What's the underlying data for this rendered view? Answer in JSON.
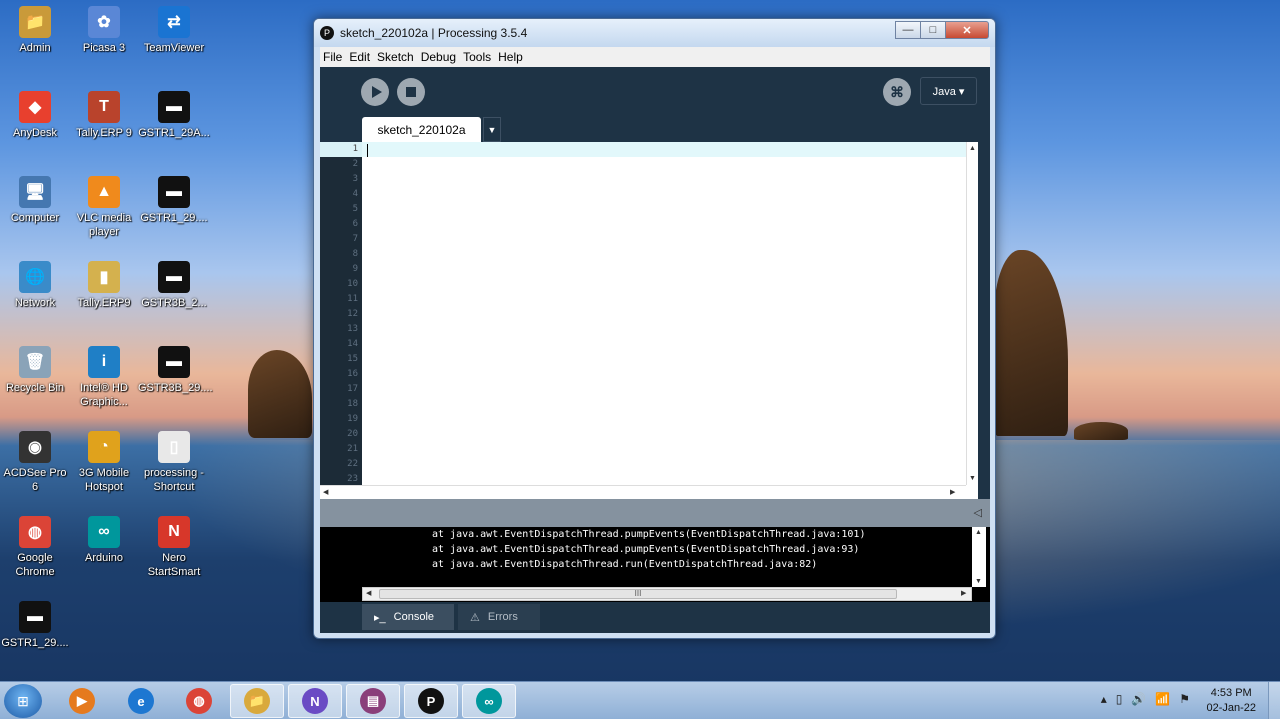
{
  "desktop": {
    "icons": [
      {
        "label": "Admin",
        "glyph": "📁",
        "color": "#c99a3a"
      },
      {
        "label": "Picasa 3",
        "glyph": "✿",
        "color": "#5a87d6"
      },
      {
        "label": "TeamViewer",
        "glyph": "⇄",
        "color": "#1a74d2"
      },
      {
        "label": "AnyDesk",
        "glyph": "◆",
        "color": "#e8402e"
      },
      {
        "label": "Tally.ERP 9",
        "glyph": "T",
        "color": "#b9432c"
      },
      {
        "label": "GSTR1_29A...",
        "glyph": "▬",
        "color": "#111111"
      },
      {
        "label": "Computer",
        "glyph": "🖥",
        "color": "#4577b0"
      },
      {
        "label": "VLC media player",
        "glyph": "▲",
        "color": "#f08a1c"
      },
      {
        "label": "GSTR1_29....",
        "glyph": "▬",
        "color": "#111111"
      },
      {
        "label": "Network",
        "glyph": "🌐",
        "color": "#3a8bc9"
      },
      {
        "label": "Tally.ERP9",
        "glyph": "▮",
        "color": "#d4b14e"
      },
      {
        "label": "GSTR3B_2...",
        "glyph": "▬",
        "color": "#111111"
      },
      {
        "label": "Recycle Bin",
        "glyph": "🗑",
        "color": "#8aa3b8"
      },
      {
        "label": "Intel® HD Graphic...",
        "glyph": "i",
        "color": "#1f7fc6"
      },
      {
        "label": "GSTR3B_29....",
        "glyph": "▬",
        "color": "#111111"
      },
      {
        "label": "ACDSee Pro 6",
        "glyph": "◉",
        "color": "#333333"
      },
      {
        "label": "3G Mobile Hotspot",
        "glyph": "◔",
        "color": "#e0a21c"
      },
      {
        "label": "processing - Shortcut",
        "glyph": "▯",
        "color": "#e8e8e8"
      },
      {
        "label": "Google Chrome",
        "glyph": "◍",
        "color": "#db4437"
      },
      {
        "label": "Arduino",
        "glyph": "∞",
        "color": "#00979c"
      },
      {
        "label": "Nero StartSmart",
        "glyph": "N",
        "color": "#d7372a"
      },
      {
        "label": "GSTR1_29....",
        "glyph": "▬",
        "color": "#111111"
      }
    ]
  },
  "window": {
    "title": "sketch_220102a | Processing 3.5.4",
    "title_icon": "P",
    "buttons": {
      "minimize": "—",
      "maximize": "□",
      "close": "✕"
    }
  },
  "menu": [
    "File",
    "Edit",
    "Sketch",
    "Debug",
    "Tools",
    "Help"
  ],
  "toolbar": {
    "mode_glyph": "⌘",
    "mode_select": "Java ▾"
  },
  "tab": {
    "name": "sketch_220102a",
    "menu_glyph": "▼"
  },
  "editor": {
    "line_numbers": [
      "1",
      "2",
      "3",
      "4",
      "5",
      "6",
      "7",
      "8",
      "9",
      "10",
      "11",
      "12",
      "13",
      "14",
      "15",
      "16",
      "17",
      "18",
      "19",
      "20",
      "21",
      "22",
      "23"
    ],
    "active_line": 1
  },
  "scroll": {
    "up": "▲",
    "down": "▼",
    "left": "◀",
    "right": "▶",
    "grip": "III"
  },
  "message_area": {
    "collapse_glyph": "◁"
  },
  "console": {
    "lines": [
      "at java.awt.EventDispatchThread.pumpEvents(EventDispatchThread.java:101)",
      "at java.awt.EventDispatchThread.pumpEvents(EventDispatchThread.java:93)",
      "at java.awt.EventDispatchThread.run(EventDispatchThread.java:82)"
    ]
  },
  "footer": {
    "console_label": "Console",
    "console_icon": "▸_",
    "errors_label": "Errors",
    "errors_icon": "⚠"
  },
  "taskbar": {
    "start_glyph": "⊞",
    "items": [
      {
        "name": "media-player",
        "glyph": "▶",
        "color": "#e57a1e",
        "active": false
      },
      {
        "name": "internet-explorer",
        "glyph": "e",
        "color": "#1d77d1",
        "active": false
      },
      {
        "name": "chrome",
        "glyph": "◍",
        "color": "#db4437",
        "active": false
      },
      {
        "name": "file-explorer",
        "glyph": "📁",
        "color": "#d9a93c",
        "active": true
      },
      {
        "name": "chrome-profile",
        "glyph": "N",
        "color": "#6a4bc4",
        "active": true
      },
      {
        "name": "winrar",
        "glyph": "▤",
        "color": "#8a3f7a",
        "active": true
      },
      {
        "name": "processing",
        "glyph": "P",
        "color": "#111111",
        "active": true
      },
      {
        "name": "arduino",
        "glyph": "∞",
        "color": "#00979c",
        "active": true
      }
    ],
    "tray": [
      "▴",
      "▯",
      "🔊",
      "📶",
      "⚑"
    ],
    "time": "4:53 PM",
    "date": "02-Jan-22"
  }
}
